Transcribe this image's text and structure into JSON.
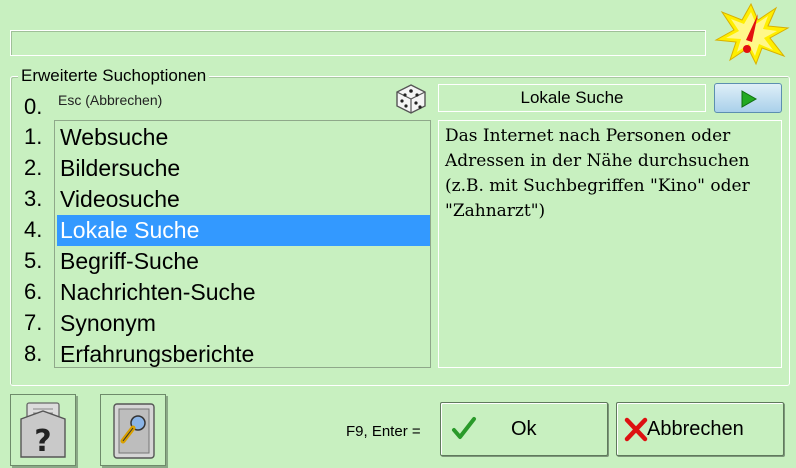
{
  "search": {
    "value": ""
  },
  "group": {
    "title": "Erweiterte Suchoptionen"
  },
  "esc_label": "Esc (Abbrechen)",
  "numbers": [
    "0.",
    "1.",
    "2.",
    "3.",
    "4.",
    "5.",
    "6.",
    "7.",
    "8."
  ],
  "options": [
    {
      "label": "Websuche",
      "selected": false
    },
    {
      "label": "Bildersuche",
      "selected": false
    },
    {
      "label": "Videosuche",
      "selected": false
    },
    {
      "label": "Lokale Suche",
      "selected": true
    },
    {
      "label": "Begriff-Suche",
      "selected": false
    },
    {
      "label": "Nachrichten-Suche",
      "selected": false
    },
    {
      "label": "Synonym",
      "selected": false
    },
    {
      "label": "Erfahrungsberichte",
      "selected": false
    }
  ],
  "selected_title": "Lokale Suche",
  "description": "Das Internet nach Personen oder Adressen in der Nähe durchsuchen (z.B. mit Suchbegriffen \"Kino\" oder \"Zahnarzt\")",
  "footer": {
    "shortcut": "F9, Enter =",
    "ok_label": "Ok",
    "cancel_label": "Abbrechen"
  },
  "icons": {
    "alert": "alert-starburst-icon",
    "dice": "dice-icon",
    "play": "play-icon",
    "help": "help-document-icon",
    "tools": "tools-document-icon",
    "check": "checkmark-icon",
    "cross": "cross-icon"
  },
  "colors": {
    "background": "#c8f0c0",
    "selection": "#3399ff",
    "check": "#2a9a2a",
    "cross": "#dd1111"
  }
}
